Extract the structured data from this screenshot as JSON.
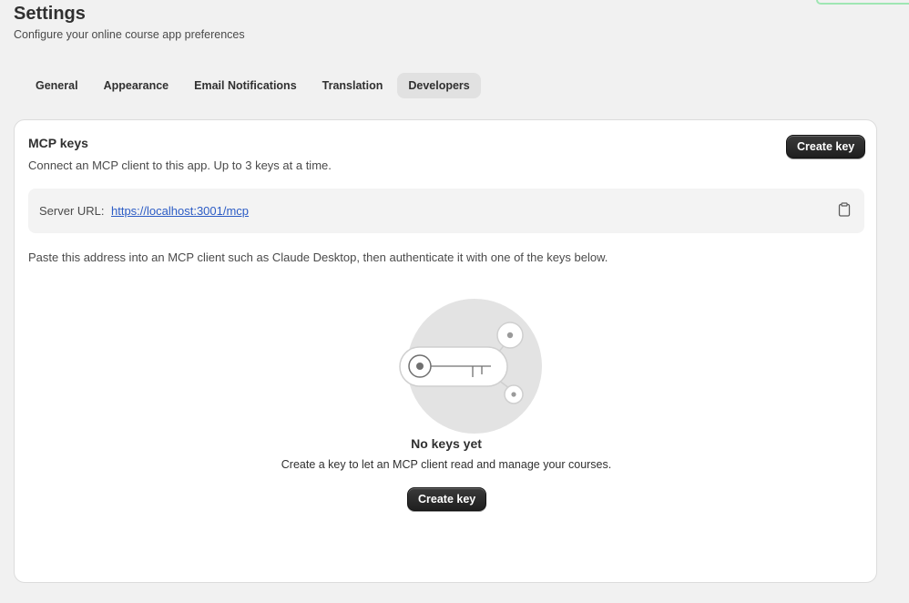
{
  "header": {
    "title": "Settings",
    "subtitle": "Configure your online course app preferences"
  },
  "tabs": [
    {
      "label": "General",
      "active": false
    },
    {
      "label": "Appearance",
      "active": false
    },
    {
      "label": "Email Notifications",
      "active": false
    },
    {
      "label": "Translation",
      "active": false
    },
    {
      "label": "Developers",
      "active": true
    }
  ],
  "mcp": {
    "title": "MCP keys",
    "description": "Connect an MCP client to this app. Up to 3 keys at a time.",
    "create_button": "Create key",
    "server_label": "Server URL:",
    "server_url": "https://localhost:3001/mcp",
    "copy_icon": "clipboard-icon",
    "paste_hint": "Paste this address into an MCP client such as Claude Desktop, then authenticate it with one of the keys below."
  },
  "empty_state": {
    "illustration": "key-illustration",
    "title": "No keys yet",
    "description": "Create a key to let an MCP client read and manage your courses.",
    "button": "Create key"
  },
  "colors": {
    "background": "#f1f1f1",
    "card": "#ffffff",
    "button_dark": "#1f1f1f",
    "link": "#2c5cc5",
    "active_tab": "#e1e1e1"
  }
}
